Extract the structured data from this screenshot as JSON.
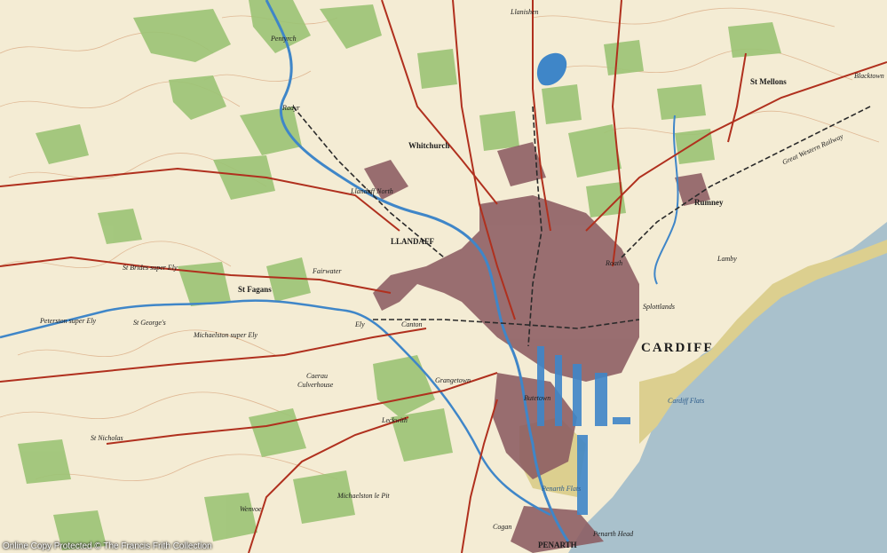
{
  "map": {
    "colors": {
      "land": "#f4ecd4",
      "sea": "#a9c1cc",
      "woodland": "#9cc475",
      "urban": "#8c5c62",
      "road": "#b0301e",
      "river": "#3f86c8",
      "mudflats": "#dccf8f",
      "contour": "#d7a37a",
      "railway": "#2a2a2a"
    },
    "places": {
      "cardiff": "CARDIFF",
      "llandaff": "LLANDAFF",
      "whitchurch": "Whitchurch",
      "llandaff_north": "Llandaff North",
      "st_fagans": "St Fagans",
      "st_brides": "St Brides super Ely",
      "st_georges": "St George's",
      "peterston": "Peterston super Ely",
      "st_nicholas": "St Nicholas",
      "canton": "Canton",
      "grangetown": "Grangetown",
      "leckwith": "Leckwith",
      "butetown": "Butetown",
      "roath": "Roath",
      "splott": "Splottlands",
      "st_mellons": "St Mellons",
      "rumney": "Rumney",
      "llanishen": "Llanishen",
      "cogan": "Cogan",
      "penarth": "PENARTH",
      "penarth_head": "Penarth Head",
      "ely": "Ely",
      "michaelston": "Michaelston le Pit",
      "wenvoe": "Wenvoe",
      "radyr": "Radyr",
      "michaelston_fedw": "Michaelston super Ely",
      "pentyrch": "Pentyrch",
      "culverhouse": "Culverhouse",
      "fairwater": "Fairwater",
      "caerau": "Caerau",
      "blackton": "Blacktown",
      "lamby": "Lamby",
      "penarth_flats": "Penarth Flats",
      "cardiff_flats": "Cardiff Flats",
      "railway_label": "Great Western Railway"
    },
    "copyright": "Online Copy Protected   © The Francis Frith Collection"
  }
}
